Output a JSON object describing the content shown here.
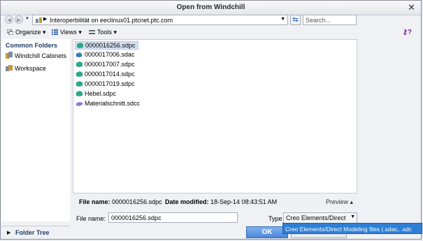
{
  "window": {
    "title": "Open from Windchill"
  },
  "address": {
    "path": "Interoperbilität on eeclinux01.ptcnet.ptc.com"
  },
  "search": {
    "placeholder": "Search..."
  },
  "toolbar": {
    "organize": "Organize",
    "views": "Views",
    "tools": "Tools"
  },
  "left_pane": {
    "header": "Common Folders",
    "items": [
      {
        "label": "Windchill Cabinets",
        "icon": "cabinet-icon"
      },
      {
        "label": "Workspace",
        "icon": "workspace-icon"
      }
    ],
    "folder_tree": "Folder Tree"
  },
  "files": [
    {
      "name": "0000016256.sdpc",
      "icon": "part-icon",
      "selected": true
    },
    {
      "name": "0000017006.sdac",
      "icon": "assembly-icon",
      "selected": false
    },
    {
      "name": "0000017007.sdpc",
      "icon": "part-icon",
      "selected": false
    },
    {
      "name": "0000017014.sdpc",
      "icon": "part-icon",
      "selected": false
    },
    {
      "name": "0000017019.sdpc",
      "icon": "part-icon",
      "selected": false
    },
    {
      "name": "Hebel.sdpc",
      "icon": "part-icon",
      "selected": false
    },
    {
      "name": "Materialschnitt.sdcc",
      "icon": "section-icon",
      "selected": false
    }
  ],
  "details": {
    "file_name_label": "File name:",
    "file_name_value": "0000016256.sdpc",
    "date_label": "Date modified:",
    "date_value": "18-Sep-14 08:43:51 AM",
    "preview": "Preview"
  },
  "bottom": {
    "file_name_label": "File name:",
    "file_name_value": "0000016256.sdpc",
    "type_label": "Type",
    "type_value": "Creo Elements/Direct",
    "type_option_highlight": "Creo Elements/Direct Modeling files (.sdac, .sdc",
    "ok": "OK",
    "cancel": "Cancel"
  },
  "colors": {
    "accent": "#4a86d8",
    "selection": "#d5e1f2",
    "header_text": "#1f3e6a"
  }
}
